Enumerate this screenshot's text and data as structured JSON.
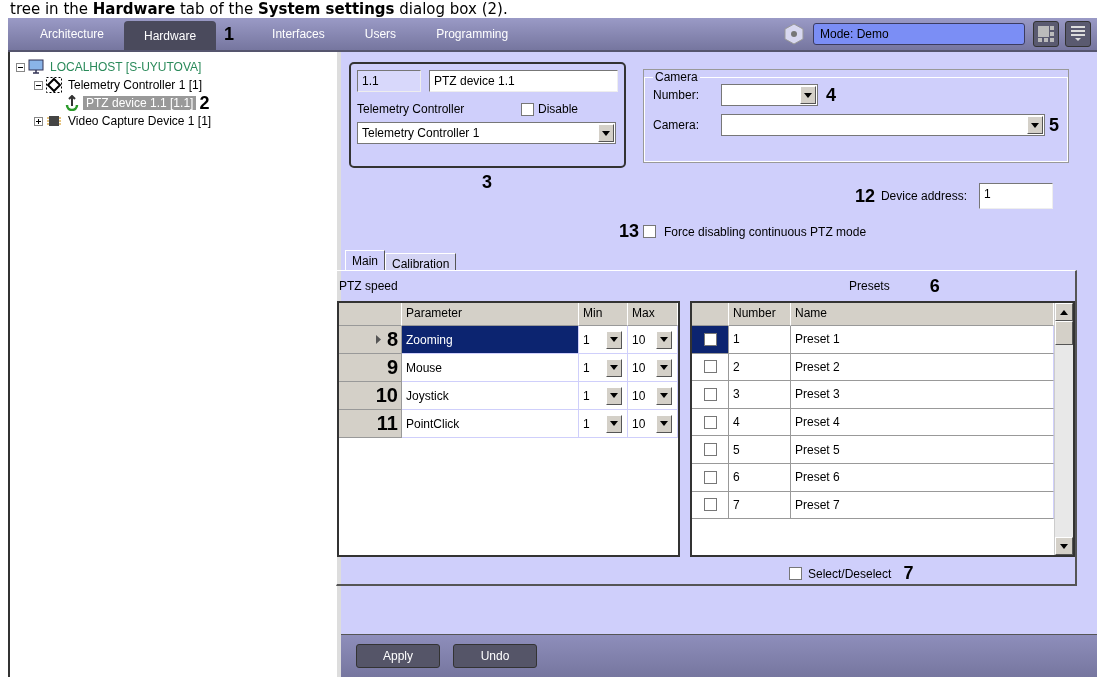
{
  "caption": "tree in the **Hardware** tab of the **System settings** dialog box (2).",
  "top_tabs": [
    {
      "label": "Architecture",
      "selected": false
    },
    {
      "label": "Hardware",
      "selected": true,
      "callout": "1"
    },
    {
      "label": "Interfaces",
      "selected": false
    },
    {
      "label": "Users",
      "selected": false
    },
    {
      "label": "Programming",
      "selected": false
    }
  ],
  "mode_field": {
    "value": "Mode: Demo"
  },
  "tree": [
    {
      "kind": "computer",
      "label": "LOCALHOST [S-UYUTOVA]",
      "expanded": true,
      "selected": false,
      "children": [
        {
          "kind": "controller",
          "label": "Telemetry Controller 1 [1]",
          "expanded": true,
          "selected": false,
          "children": [
            {
              "kind": "ptz",
              "label": "PTZ device 1.1 [1.1]",
              "selected": true,
              "callout": "2"
            }
          ]
        },
        {
          "kind": "capture",
          "label": "Video Capture Device 1 [1]",
          "expanded": false,
          "selected": false
        }
      ]
    }
  ],
  "device": {
    "id": "1.1",
    "name": "PTZ device 1.1",
    "controller_label": "Telemetry Controller",
    "disable": {
      "label": "Disable",
      "checked": false
    },
    "controller": "Telemetry Controller 1",
    "callout": "3"
  },
  "camera_group": {
    "title": "Camera",
    "number_label": "Number:",
    "number_callout": "4",
    "camera_label": "Camera:",
    "camera_callout": "5"
  },
  "device_address": {
    "callout": "12",
    "label": "Device address:",
    "value": "1"
  },
  "force_ptz": {
    "callout": "13",
    "label": "Force disabling continuous PTZ mode",
    "checked": false
  },
  "panel_tabs": [
    {
      "label": "Main",
      "selected": true
    },
    {
      "label": "Calibration",
      "selected": false
    }
  ],
  "ptz_speed": {
    "title": "PTZ speed",
    "columns": [
      "Parameter",
      "Min",
      "Max"
    ],
    "rows": [
      {
        "callout": "8",
        "name": "Zooming",
        "min": "1",
        "max": "10",
        "selected": true
      },
      {
        "callout": "9",
        "name": "Mouse",
        "min": "1",
        "max": "10",
        "selected": false
      },
      {
        "callout": "10",
        "name": "Joystick",
        "min": "1",
        "max": "10",
        "selected": false
      },
      {
        "callout": "11",
        "name": "PointClick",
        "min": "1",
        "max": "10",
        "selected": false
      }
    ]
  },
  "presets": {
    "title": "Presets",
    "callout": "6",
    "columns": [
      "Number",
      "Name"
    ],
    "rows": [
      {
        "number": "1",
        "name": "Preset 1",
        "checked": false,
        "selected": true
      },
      {
        "number": "2",
        "name": "Preset 2",
        "checked": false,
        "selected": false
      },
      {
        "number": "3",
        "name": "Preset 3",
        "checked": false,
        "selected": false
      },
      {
        "number": "4",
        "name": "Preset 4",
        "checked": false,
        "selected": false
      },
      {
        "number": "5",
        "name": "Preset 5",
        "checked": false,
        "selected": false
      },
      {
        "number": "6",
        "name": "Preset 6",
        "checked": false,
        "selected": false
      },
      {
        "number": "7",
        "name": "Preset 7",
        "checked": false,
        "selected": false
      }
    ],
    "select_all": {
      "label": "Select/Deselect",
      "checked": false,
      "callout": "7"
    }
  },
  "buttons": [
    "Apply",
    "Undo"
  ]
}
